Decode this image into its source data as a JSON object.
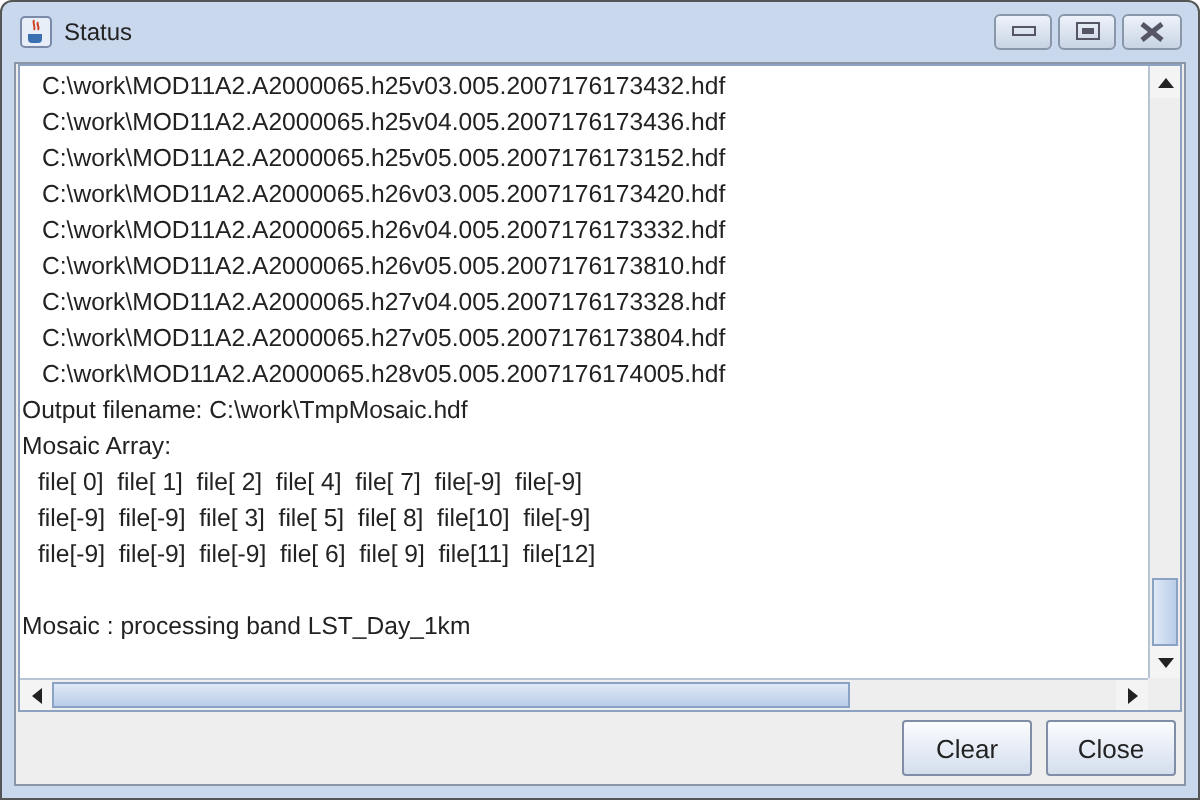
{
  "window": {
    "title": "Status"
  },
  "log_lines": [
    {
      "text": "C:\\work\\MOD11A2.A2000065.h25v03.005.2007176173432.hdf",
      "kind": "path"
    },
    {
      "text": "C:\\work\\MOD11A2.A2000065.h25v04.005.2007176173436.hdf",
      "kind": "path"
    },
    {
      "text": "C:\\work\\MOD11A2.A2000065.h25v05.005.2007176173152.hdf",
      "kind": "path"
    },
    {
      "text": "C:\\work\\MOD11A2.A2000065.h26v03.005.2007176173420.hdf",
      "kind": "path"
    },
    {
      "text": "C:\\work\\MOD11A2.A2000065.h26v04.005.2007176173332.hdf",
      "kind": "path"
    },
    {
      "text": "C:\\work\\MOD11A2.A2000065.h26v05.005.2007176173810.hdf",
      "kind": "path"
    },
    {
      "text": "C:\\work\\MOD11A2.A2000065.h27v04.005.2007176173328.hdf",
      "kind": "path"
    },
    {
      "text": "C:\\work\\MOD11A2.A2000065.h27v05.005.2007176173804.hdf",
      "kind": "path"
    },
    {
      "text": "C:\\work\\MOD11A2.A2000065.h28v05.005.2007176174005.hdf",
      "kind": "path"
    },
    {
      "text": "Output filename: C:\\work\\TmpMosaic.hdf",
      "kind": "plain"
    },
    {
      "text": "Mosaic Array:",
      "kind": "plain"
    },
    {
      "text": "file[ 0]  file[ 1]  file[ 2]  file[ 4]  file[ 7]  file[-9]  file[-9]",
      "kind": "array"
    },
    {
      "text": "file[-9]  file[-9]  file[ 3]  file[ 5]  file[ 8]  file[10]  file[-9]",
      "kind": "array"
    },
    {
      "text": "file[-9]  file[-9]  file[-9]  file[ 6]  file[ 9]  file[11]  file[12]",
      "kind": "array"
    },
    {
      "text": "Mosaic : processing band LST_Day_1km",
      "kind": "status"
    }
  ],
  "buttons": [
    "Clear",
    "Close"
  ]
}
